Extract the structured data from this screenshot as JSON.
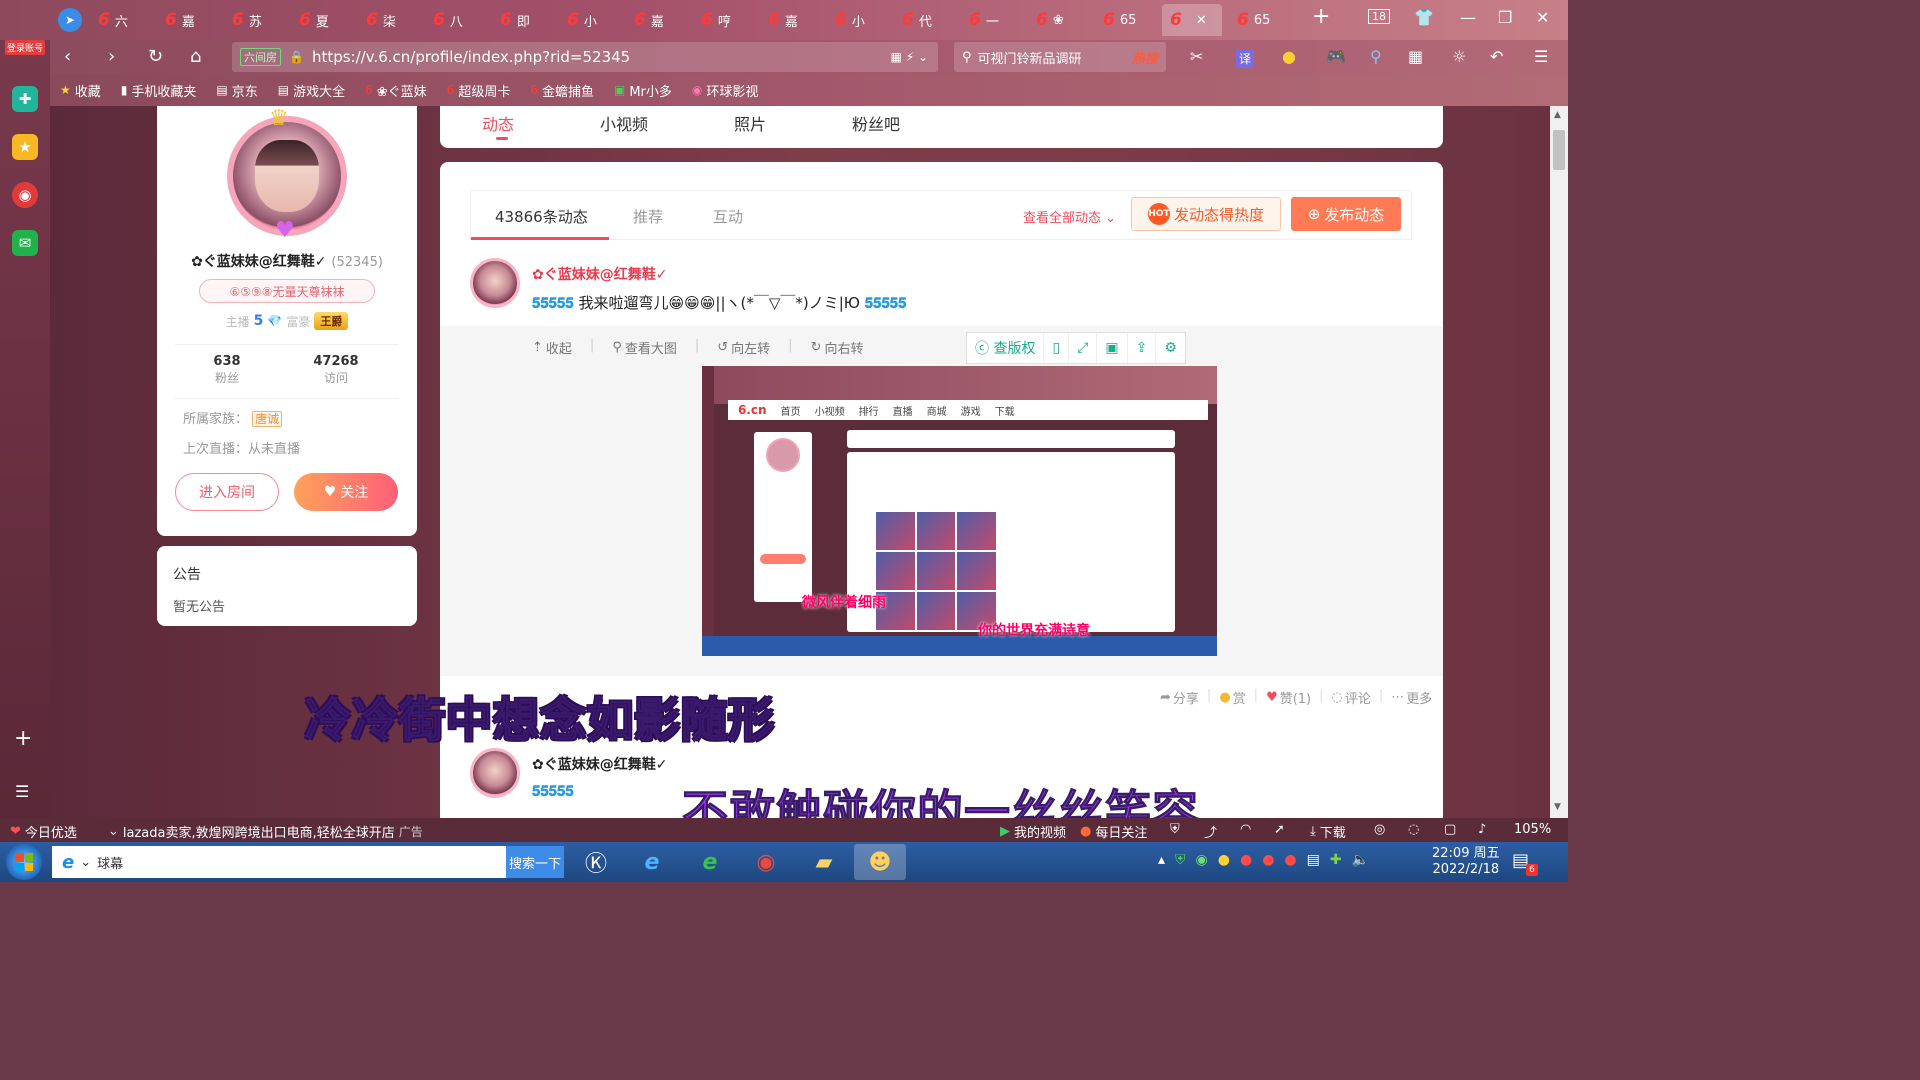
{
  "browser": {
    "login_label": "登录账号",
    "tabs": [
      {
        "label": "六"
      },
      {
        "label": "嘉"
      },
      {
        "label": "苏"
      },
      {
        "label": "夏"
      },
      {
        "label": "柒"
      },
      {
        "label": "八"
      },
      {
        "label": "即"
      },
      {
        "label": "小"
      },
      {
        "label": "嘉"
      },
      {
        "label": "哼"
      },
      {
        "label": "嘉"
      },
      {
        "label": "小"
      },
      {
        "label": "代"
      },
      {
        "label": "一"
      },
      {
        "label": "❀"
      },
      {
        "label": "65"
      },
      {
        "label": "",
        "active": true
      },
      {
        "label": "65"
      }
    ],
    "tab_count": "18",
    "url": "https://v.6.cn/profile/index.php?rid=52345",
    "site_badge": "六间房",
    "search_text": "可视门铃新品调研",
    "search_hot": "热搜",
    "translate_label": "译"
  },
  "bookmarks": [
    {
      "label": "收藏",
      "icon": "star-icon"
    },
    {
      "label": "手机收藏夹",
      "icon": "phone-icon"
    },
    {
      "label": "京东",
      "icon": "doc-icon"
    },
    {
      "label": "游戏大全",
      "icon": "doc-icon"
    },
    {
      "label": "❀ぐ蓝妹",
      "icon": "six-icon"
    },
    {
      "label": "超级周卡",
      "icon": "six-icon"
    },
    {
      "label": "金蟾捕鱼",
      "icon": "six-icon"
    },
    {
      "label": "Mr小多",
      "icon": "app-icon"
    },
    {
      "label": "环球影视",
      "icon": "globe-icon"
    }
  ],
  "profile": {
    "nickname": "✿ぐ蓝妹妹@红舞鞋✓",
    "rid": "(52345)",
    "rank_badge": "⑥⑤⑨⑧无量天尊袜袜",
    "anchor_label": "主播",
    "anchor_level": "5",
    "rich_label": "富豪",
    "rich_badge": "王爵",
    "fans_count": "638",
    "fans_label": "粉丝",
    "visits_count": "47268",
    "visits_label": "访问",
    "family_label": "所属家族：",
    "family_value": "唐诚",
    "last_live": "上次直播：从未直播",
    "enter_room": "进入房间",
    "follow": "关注"
  },
  "notice": {
    "title": "公告",
    "body": "暂无公告"
  },
  "page_tabs": [
    {
      "label": "动态",
      "active": true
    },
    {
      "label": "小视频"
    },
    {
      "label": "照片"
    },
    {
      "label": "粉丝吧"
    }
  ],
  "feed": {
    "tabs": [
      {
        "label": "43866条动态",
        "active": true
      },
      {
        "label": "推荐"
      },
      {
        "label": "互动"
      }
    ],
    "view_all": "查看全部动态",
    "hot_post": "发动态得热度",
    "hot_icon_text": "HOT",
    "publish": "发布动态",
    "post1": {
      "author": "✿ぐ蓝妹妹@红舞鞋✓",
      "text_emojis_start": "𝟓𝟓𝟓𝟓𝟓",
      "text_mid": "我来啦遛弯儿😁😁😁||ヽ(*￣▽￣*)ノミ|Ю",
      "text_emojis_end": "𝟓𝟓𝟓𝟓𝟓"
    },
    "media_tools": [
      "收起",
      "查看大图",
      "向左转",
      "向右转"
    ],
    "media_right_tools": [
      "查版权"
    ],
    "screenshot": {
      "brand": "6.cn",
      "nav_items": [
        "首页",
        "小视频",
        "排行",
        "直播",
        "商城",
        "游戏",
        "下载"
      ],
      "caption1": "微风伴着细雨",
      "caption2": "你的世界充满诗意"
    },
    "actions": [
      {
        "label": "分享"
      },
      {
        "label": "赏"
      },
      {
        "label": "赞(1)"
      },
      {
        "label": "评论"
      },
      {
        "label": "更多"
      }
    ],
    "post2": {
      "author": "✿ぐ蓝妹妹@红舞鞋✓",
      "text_emojis_start": "𝟓𝟓𝟓𝟓𝟓"
    }
  },
  "lyrics": {
    "line1": "冷冷街中想念如影随形",
    "line2": "不敢触碰你的一丝丝笑容"
  },
  "statusbar": {
    "today": "今日优选",
    "ad": "lazada卖家,敦煌网跨境出口电商,轻松全球开店",
    "ad_tag": "广告",
    "my_video": "我的视频",
    "daily": "每日关注",
    "download": "下载",
    "zoom": "105%"
  },
  "taskbar": {
    "search_text": "球幕",
    "search_button": "搜索一下",
    "time": "22:09 周五",
    "date": "2022/2/18",
    "notif_count": "6"
  }
}
